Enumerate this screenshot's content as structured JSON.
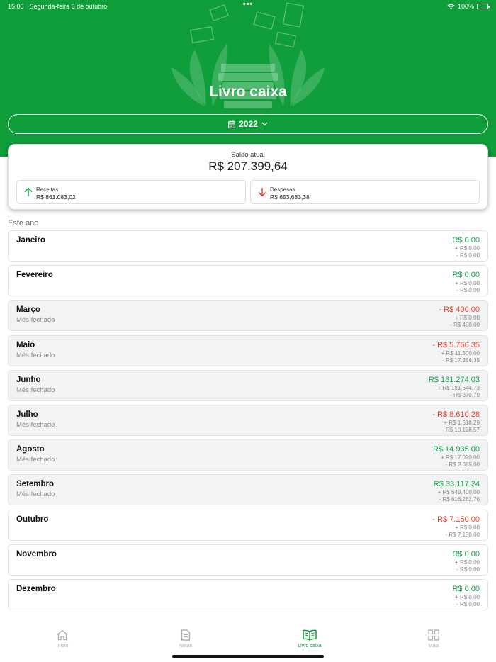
{
  "status_bar": {
    "time": "15:05",
    "date": "Segunda-feira 3 de outubro",
    "battery": "100%"
  },
  "header": {
    "title": "Livro caixa",
    "year": "2022"
  },
  "summary": {
    "label": "Saldo atual",
    "balance": "R$ 207.399,64",
    "income_label": "Receitas",
    "income_value": "R$ 861.083,02",
    "expense_label": "Despesas",
    "expense_value": "R$ 653.683,38"
  },
  "section_title": "Este ano",
  "months": [
    {
      "name": "Janeiro",
      "status": "",
      "total": "R$ 0,00",
      "income": "+ R$ 0,00",
      "expense": "- R$ 0,00",
      "positive": true,
      "closed": false
    },
    {
      "name": "Fevereiro",
      "status": "",
      "total": "R$ 0,00",
      "income": "+ R$ 0,00",
      "expense": "- R$ 0,00",
      "positive": true,
      "closed": false
    },
    {
      "name": "Março",
      "status": "Mês fechado",
      "total": "- R$ 400,00",
      "income": "+ R$ 0,00",
      "expense": "- R$ 400,00",
      "positive": false,
      "closed": true
    },
    {
      "name": "Maio",
      "status": "Mês fechado",
      "total": "- R$ 5.766,35",
      "income": "+ R$ 11.500,00",
      "expense": "- R$ 17.266,35",
      "positive": false,
      "closed": true
    },
    {
      "name": "Junho",
      "status": "Mês fechado",
      "total": "R$ 181.274,03",
      "income": "+ R$ 181.644,73",
      "expense": "- R$ 370,70",
      "positive": true,
      "closed": true
    },
    {
      "name": "Julho",
      "status": "Mês fechado",
      "total": "- R$ 8.610,28",
      "income": "+ R$ 1.518,29",
      "expense": "- R$ 10.128,57",
      "positive": false,
      "closed": true
    },
    {
      "name": "Agosto",
      "status": "Mês fechado",
      "total": "R$ 14.935,00",
      "income": "+ R$ 17.020,00",
      "expense": "- R$ 2.085,00",
      "positive": true,
      "closed": true
    },
    {
      "name": "Setembro",
      "status": "Mês fechado",
      "total": "R$ 33.117,24",
      "income": "+ R$ 649.400,00",
      "expense": "- R$ 616.282,76",
      "positive": true,
      "closed": true
    },
    {
      "name": "Outubro",
      "status": "",
      "total": "- R$ 7.150,00",
      "income": "+ R$ 0,00",
      "expense": "- R$ 7.150,00",
      "positive": false,
      "closed": false
    },
    {
      "name": "Novembro",
      "status": "",
      "total": "R$ 0,00",
      "income": "+ R$ 0,00",
      "expense": "- R$ 0,00",
      "positive": true,
      "closed": false
    },
    {
      "name": "Dezembro",
      "status": "",
      "total": "R$ 0,00",
      "income": "+ R$ 0,00",
      "expense": "- R$ 0,00",
      "positive": true,
      "closed": false
    }
  ],
  "tabs": [
    {
      "label": "Início",
      "icon": "home-icon",
      "active": false
    },
    {
      "label": "Notas",
      "icon": "document-icon",
      "active": false
    },
    {
      "label": "Livro caixa",
      "icon": "book-icon",
      "active": true
    },
    {
      "label": "Mais",
      "icon": "grid-icon",
      "active": false
    }
  ],
  "colors": {
    "brand": "#0f9e3a",
    "positive": "#16a34a",
    "negative": "#e0452b",
    "closed_bg": "#f2f3f5"
  }
}
